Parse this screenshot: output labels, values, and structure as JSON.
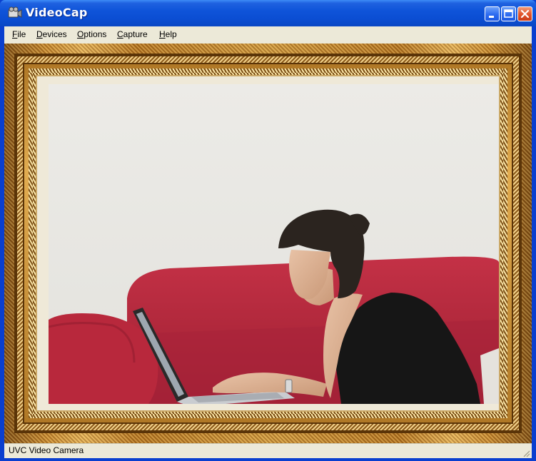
{
  "window": {
    "title": "VideoCap",
    "icon": "camera-app-icon",
    "controls": [
      "minimize-icon",
      "maximize-icon",
      "close-icon"
    ]
  },
  "menu": {
    "file": {
      "first": "F",
      "rest": "ile"
    },
    "devices": {
      "first": "D",
      "rest": "evices"
    },
    "options": {
      "first": "O",
      "rest": "ptions"
    },
    "capture": {
      "first": "C",
      "rest": "apture"
    },
    "help": {
      "first": "H",
      "rest": "elp"
    }
  },
  "preview": {
    "overlay_frame": "ornate-gold-picture-frame",
    "scene": "woman-with-laptop-on-red-sofa"
  },
  "status": {
    "device": "UVC Video Camera"
  },
  "colors": {
    "titlebar": "#0b4ed3",
    "menubar": "#ece9d8",
    "frame_gold": "#d29a3e",
    "sofa_red": "#b3283a"
  }
}
